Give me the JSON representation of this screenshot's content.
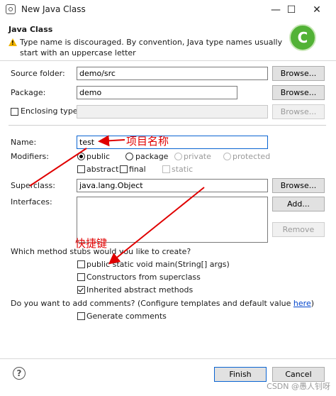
{
  "window": {
    "title": "New Java Class",
    "minimize_glyph": "—",
    "maximize_glyph": "☐",
    "close_glyph": "✕"
  },
  "header": {
    "title": "Java Class",
    "warning": "Type name is discouraged. By convention, Java type names usually start with an uppercase letter",
    "banner_glyph": "C"
  },
  "form": {
    "source_folder": {
      "label": "Source folder:",
      "value": "demo/src",
      "browse": "Browse..."
    },
    "package": {
      "label": "Package:",
      "value": "demo",
      "browse": "Browse..."
    },
    "enclosing_type": {
      "label": "Enclosing type:",
      "value": "",
      "browse": "Browse...",
      "checked": false
    },
    "name": {
      "label": "Name:",
      "value": "test"
    },
    "modifiers": {
      "label": "Modifiers:",
      "access": [
        "public",
        "package",
        "private",
        "protected"
      ],
      "selected": "public",
      "flags": [
        "abstract",
        "final",
        "static"
      ]
    },
    "superclass": {
      "label": "Superclass:",
      "value": "java.lang.Object",
      "browse": "Browse..."
    },
    "interfaces": {
      "label": "Interfaces:",
      "add": "Add...",
      "remove": "Remove"
    },
    "stubs": {
      "question": "Which method stubs would you like to create?",
      "options": [
        {
          "label": "public static void main(String[] args)",
          "checked": false
        },
        {
          "label": "Constructors from superclass",
          "checked": false
        },
        {
          "label": "Inherited abstract methods",
          "checked": true
        }
      ]
    },
    "comments": {
      "question_prefix": "Do you want to add comments? (Configure templates and default value ",
      "link": "here",
      "question_suffix": ")",
      "option": "Generate comments",
      "checked": false
    }
  },
  "footer": {
    "help_glyph": "?",
    "finish": "Finish",
    "cancel": "Cancel"
  },
  "annotations": {
    "name_note": "项目名称",
    "shortcut_note": "快捷键",
    "color": "#e00000"
  },
  "watermark": "CSDN @愚人钊呀"
}
